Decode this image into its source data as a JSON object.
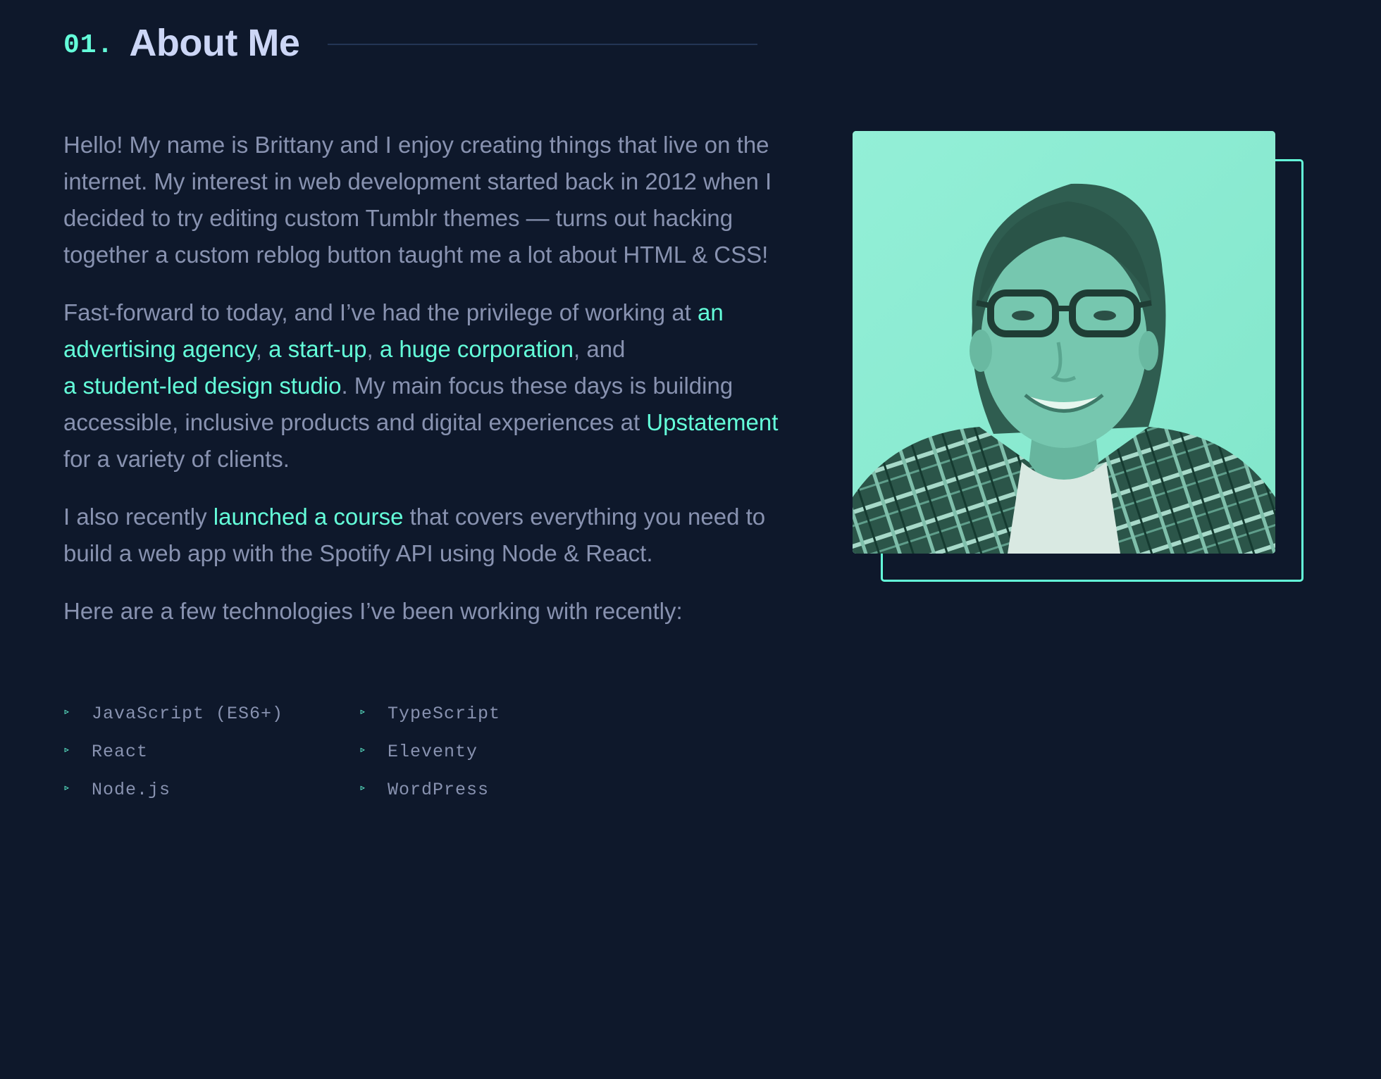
{
  "heading": {
    "number": "01.",
    "title": "About Me"
  },
  "about": {
    "p1": "Hello! My name is Brittany and I enjoy creating things that live on the internet. My interest in web development started back in 2012 when I decided to try editing custom Tumblr themes — turns out hacking together a custom reblog button taught me a lot about HTML & CSS!",
    "p2": {
      "intro": "Fast-forward to today, and I’ve had the privilege of working at ",
      "link_agency": "an advertising agency",
      "sep1": ", ",
      "link_startup": "a start-up",
      "sep2": ", ",
      "link_corporation": "a huge corporation",
      "sep3": ", and ",
      "link_studio": "a student-led design studio",
      "middle": ". My main focus these days is building accessible, inclusive products and digital experiences at ",
      "link_upstatement": "Upstatement",
      "outro": " for a variety of clients."
    },
    "p3": {
      "intro": "I also recently ",
      "link_course": "launched a course",
      "outro": " that covers everything you need to build a web app with the Spotify API using Node & React."
    },
    "p4": "Here are a few technologies I’ve been working with recently:"
  },
  "skills": [
    "JavaScript (ES6+)",
    "TypeScript",
    "React",
    "Eleventy",
    "Node.js",
    "WordPress"
  ],
  "icons": {
    "bullet": "triangle-right-icon",
    "bullet_glyph": "▹"
  },
  "colors": {
    "background": "#0e182b",
    "accent": "#64ffda",
    "heading": "#ccd6f6",
    "text": "#8892b0",
    "rule": "#233554",
    "photo_tint": "#8cedd4"
  }
}
